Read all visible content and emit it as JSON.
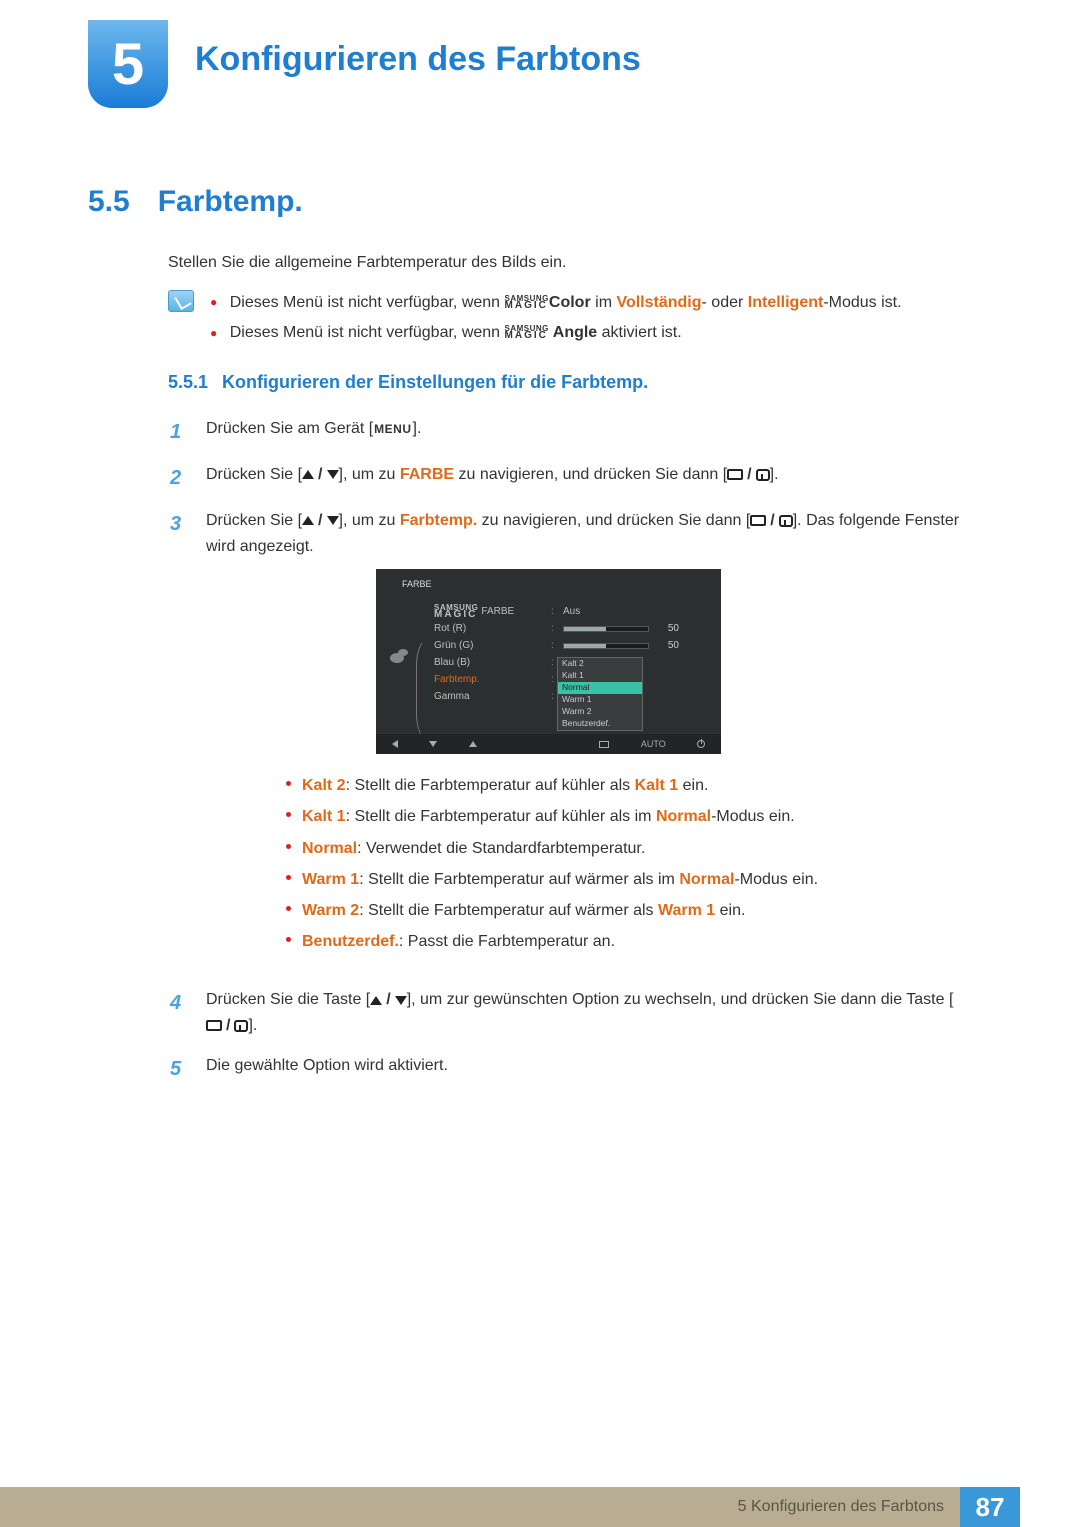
{
  "chapter": {
    "num": "5",
    "title": "Konfigurieren des Farbtons"
  },
  "section": {
    "num": "5.5",
    "title": "Farbtemp."
  },
  "intro": "Stellen Sie die allgemeine Farbtemperatur des Bilds ein.",
  "magic": {
    "top": "SAMSUNG",
    "bot": "MAGIC"
  },
  "notes": {
    "n1a": "Dieses Menü ist nicht verfügbar, wenn ",
    "n1b": "Color",
    "n1c": " im ",
    "n1d": "Vollständig",
    "n1e": "- oder ",
    "n1f": "Intelligent",
    "n1g": "-Modus ist.",
    "n2a": "Dieses Menü ist nicht verfügbar, wenn ",
    "n2b": " Angle",
    "n2c": " aktiviert ist."
  },
  "subsection": {
    "num": "5.5.1",
    "title": "Konfigurieren der Einstellungen für die Farbtemp."
  },
  "steps": {
    "s1a": "Drücken Sie am Gerät [",
    "s1b": "].",
    "menu": "MENU",
    "s2a": "Drücken Sie [",
    "s2b": "], um zu ",
    "s2c": "FARBE",
    "s2d": " zu navigieren, und drücken Sie dann [",
    "s2e": "].",
    "s3a": "Drücken Sie [",
    "s3b": "], um zu ",
    "s3c": "Farbtemp.",
    "s3d": " zu navigieren, und drücken Sie dann [",
    "s3e": "]. Das folgende Fenster wird angezeigt.",
    "s4a": "Drücken Sie die Taste [",
    "s4b": "], um zur gewünschten Option zu wechseln, und drücken Sie dann die Taste [",
    "s4c": "].",
    "s5": "Die gewählte Option wird aktiviert."
  },
  "osd": {
    "title": "FARBE",
    "left": [
      "FARBE",
      "Rot (R)",
      "Grün (G)",
      "Blau (B)",
      "Farbtemp.",
      "Gamma"
    ],
    "aus": "Aus",
    "rot": "50",
    "gruen": "50",
    "dd": [
      "Kalt 2",
      "Kalt 1",
      "Normal",
      "Warm 1",
      "Warm 2",
      "Benutzerdef."
    ],
    "auto": "AUTO"
  },
  "bullets": {
    "b1a": "Kalt 2",
    "b1b": ": Stellt die Farbtemperatur auf kühler als ",
    "b1c": "Kalt 1",
    "b1d": " ein.",
    "b2a": "Kalt 1",
    "b2b": ": Stellt die Farbtemperatur auf kühler als im ",
    "b2c": "Normal",
    "b2d": "-Modus ein.",
    "b3a": "Normal",
    "b3b": ": Verwendet die Standardfarbtemperatur.",
    "b4a": "Warm 1",
    "b4b": ": Stellt die Farbtemperatur auf wärmer als im ",
    "b4c": "Normal",
    "b4d": "-Modus ein.",
    "b5a": "Warm 2",
    "b5b": ": Stellt die Farbtemperatur auf wärmer als ",
    "b5c": "Warm 1",
    "b5d": " ein.",
    "b6a": "Benutzerdef.",
    "b6b": ": Passt die Farbtemperatur an."
  },
  "footer": {
    "text": "5 Konfigurieren des Farbtons",
    "page": "87"
  }
}
